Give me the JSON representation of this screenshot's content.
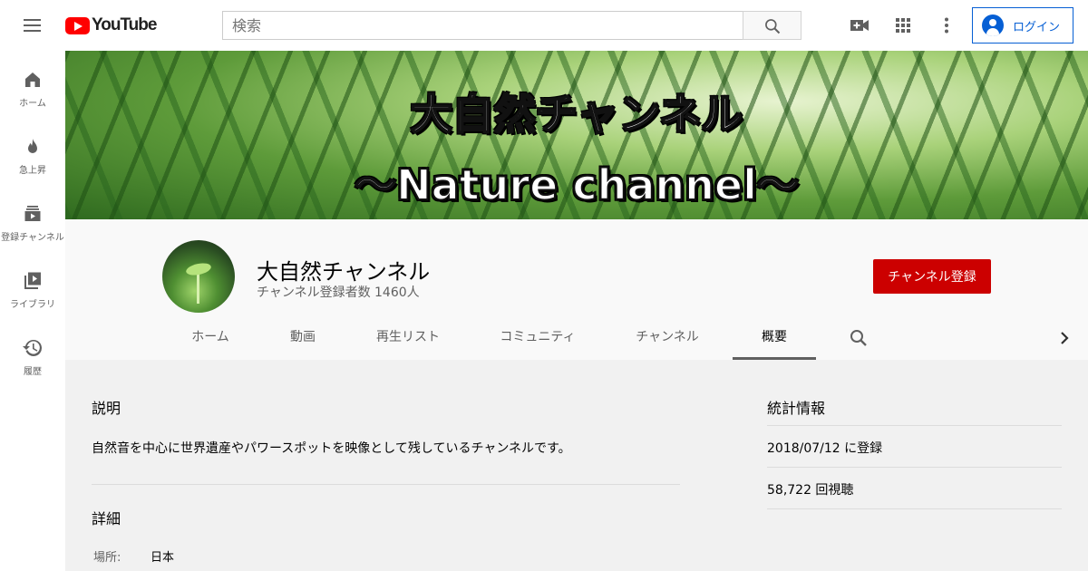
{
  "masthead": {
    "logo_text": "YouTube",
    "search_placeholder": "検索",
    "login_label": "ログイン"
  },
  "guide": {
    "items": [
      {
        "label": "ホーム",
        "icon": "home-icon"
      },
      {
        "label": "急上昇",
        "icon": "flame-icon"
      },
      {
        "label": "登録チャンネル",
        "icon": "subscriptions-icon"
      },
      {
        "label": "ライブラリ",
        "icon": "library-icon"
      },
      {
        "label": "履歴",
        "icon": "history-icon"
      }
    ]
  },
  "banner": {
    "line1": "大自然チャンネル",
    "line2": "～Nature channel～"
  },
  "channel": {
    "name": "大自然チャンネル",
    "subscribers": "チャンネル登録者数 1460人",
    "subscribe_label": "チャンネル登録"
  },
  "tabs": [
    {
      "label": "ホーム"
    },
    {
      "label": "動画"
    },
    {
      "label": "再生リスト"
    },
    {
      "label": "コミュニティ"
    },
    {
      "label": "チャンネル"
    },
    {
      "label": "概要",
      "active": true
    }
  ],
  "about": {
    "description_title": "説明",
    "description": "自然音を中心に世界遺産やパワースポットを映像として残しているチャンネルです。",
    "details_title": "詳細",
    "location_key": "場所:",
    "location_value": "日本",
    "stats_title": "統計情報",
    "joined": "2018/07/12 に登録",
    "views": "58,722 回視聴"
  },
  "colors": {
    "brand_red": "#ff0000",
    "subscribe_red": "#cc0000",
    "link_blue": "#065fd4"
  }
}
